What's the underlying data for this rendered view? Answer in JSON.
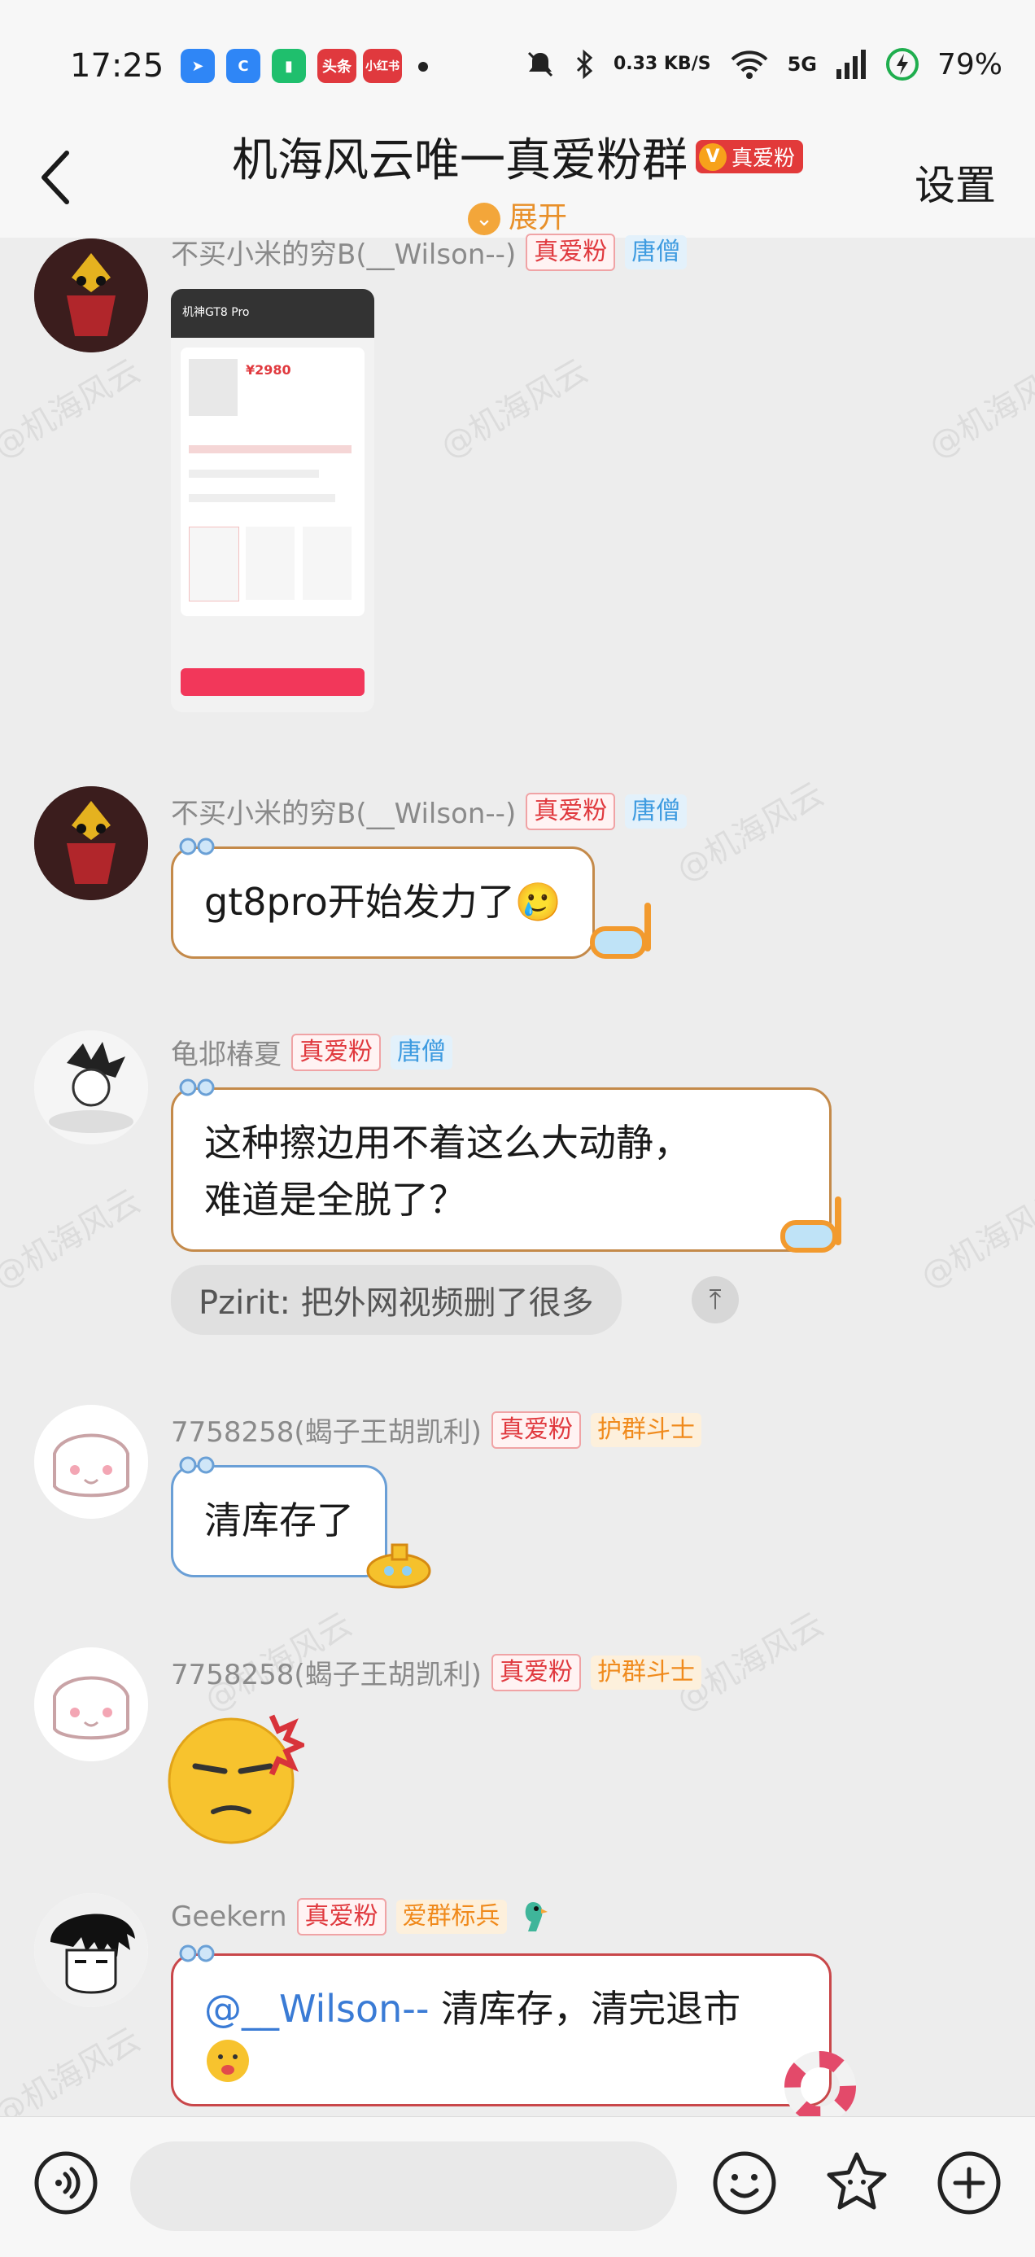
{
  "status_bar": {
    "time": "17:25",
    "app_icons": [
      "腾讯新闻",
      "快看",
      "电池管家",
      "头条",
      "小红书"
    ],
    "network_speed": "0.33 KB/S",
    "signal": "5G",
    "battery": "79%"
  },
  "nav": {
    "back_icon": "chevron-left-icon",
    "title": "机海风云唯一真爱粉群",
    "title_badge": "真爱粉",
    "expand_label": "展开",
    "settings_label": "设置"
  },
  "watermark": "@机海风云",
  "messages": [
    {
      "sender": "不买小米的穷B(__Wilson--)",
      "tags": [
        "真爱粉",
        "唐僧"
      ],
      "type": "image",
      "image_title": "机神GT8 Pro",
      "image_price": "¥2980"
    },
    {
      "sender": "不买小米的穷B(__Wilson--)",
      "tags": [
        "真爱粉",
        "唐僧"
      ],
      "type": "text",
      "text": "gt8pro开始发力了🥲"
    },
    {
      "sender": "龟邶椿夏",
      "tags": [
        "真爱粉",
        "唐僧"
      ],
      "type": "text",
      "text": "这种擦边用不着这么大动静，难道是全脱了？",
      "text_line1": "这种擦边用不着这么大动静，",
      "text_line2": "难道是全脱了？",
      "quote": "Pzirit: 把外网视频删了很多"
    },
    {
      "sender": "7758258(蝎子王胡凯利)",
      "tags": [
        "真爱粉",
        "护群斗士"
      ],
      "type": "text",
      "text": "清库存了"
    },
    {
      "sender": "7758258(蝎子王胡凯利)",
      "tags": [
        "真爱粉",
        "护群斗士"
      ],
      "type": "sticker",
      "sticker": "angry-face-icon"
    },
    {
      "sender": "Geekern",
      "tags": [
        "真爱粉",
        "爱群标兵"
      ],
      "type": "text",
      "mention": "@__Wilson--",
      "text": " 清库存，清完退市"
    }
  ],
  "input_bar": {
    "voice_icon": "voice-icon",
    "emoji_icon": "emoji-icon",
    "sticker_icon": "star-face-icon",
    "plus_icon": "plus-icon"
  }
}
